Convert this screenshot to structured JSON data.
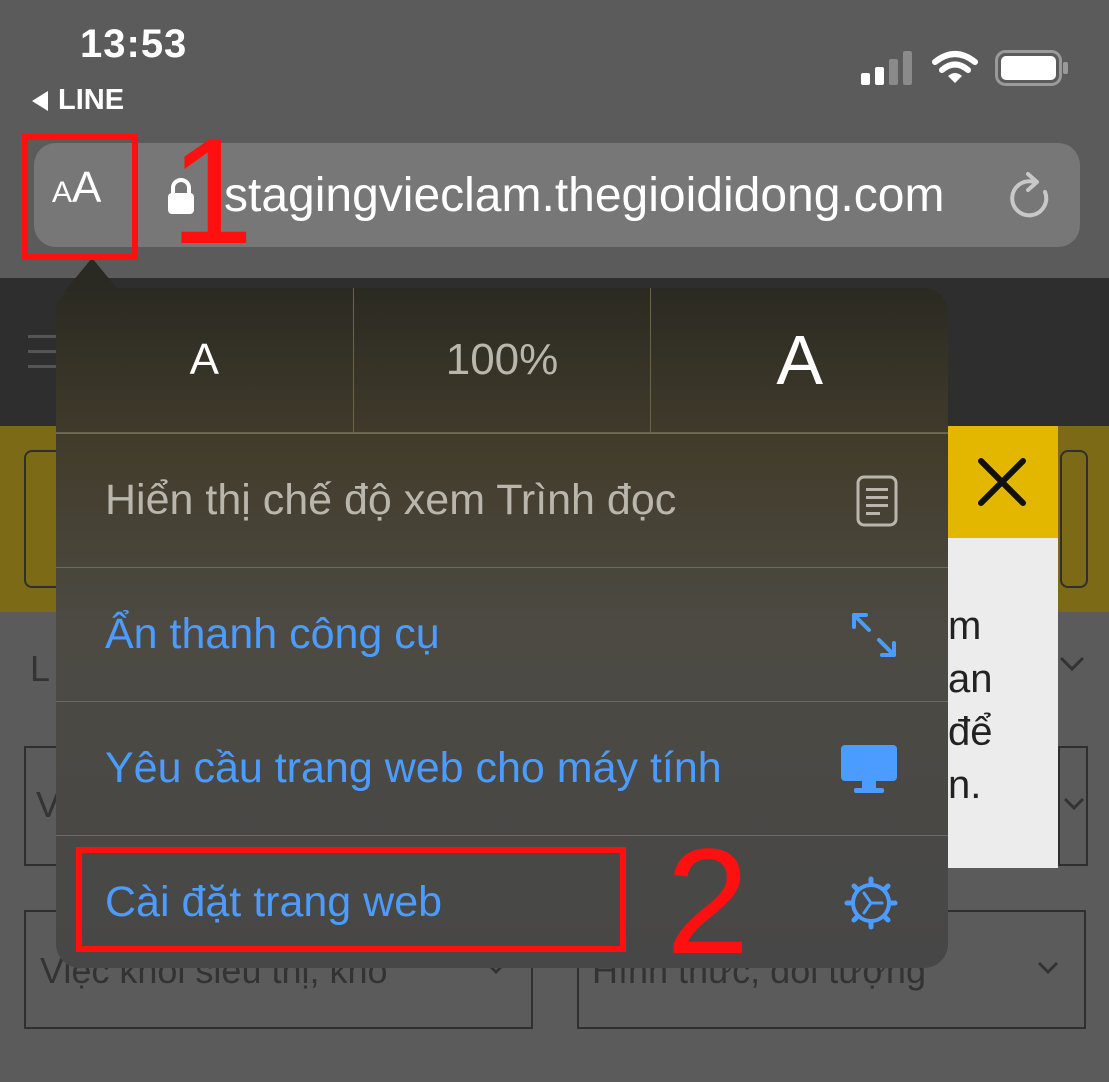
{
  "status_bar": {
    "time": "13:53",
    "back_app": "LINE"
  },
  "address_bar": {
    "text_size_button": {
      "small": "A",
      "big": "A"
    },
    "url": "stagingvieclam.thegioididong.com"
  },
  "zoom_controls": {
    "decrease_label": "A",
    "zoom_level": "100%",
    "increase_label": "A"
  },
  "menu": {
    "items": [
      {
        "label": "Hiển thị chế độ xem Trình đọc",
        "icon": "reader-icon",
        "enabled": false
      },
      {
        "label": "Ẩn thanh công cụ",
        "icon": "expand-arrows-icon",
        "enabled": true
      },
      {
        "label": "Yêu cầu trang web cho máy tính",
        "icon": "desktop-icon",
        "enabled": true
      },
      {
        "label": "Cài đặt trang web",
        "icon": "gear-icon",
        "enabled": true
      }
    ]
  },
  "background_page": {
    "notice_lines": [
      "m",
      "an",
      "để",
      "n."
    ],
    "field_1": "Việc khối siêu thị, kho",
    "field_2": "Hình thức, đối tượng"
  },
  "annotations": {
    "step_1": "1",
    "step_2": "2"
  },
  "colors": {
    "accent_blue": "#4c9bff",
    "annotation_red": "#ff1010",
    "brand_yellow": "#e3b700"
  }
}
